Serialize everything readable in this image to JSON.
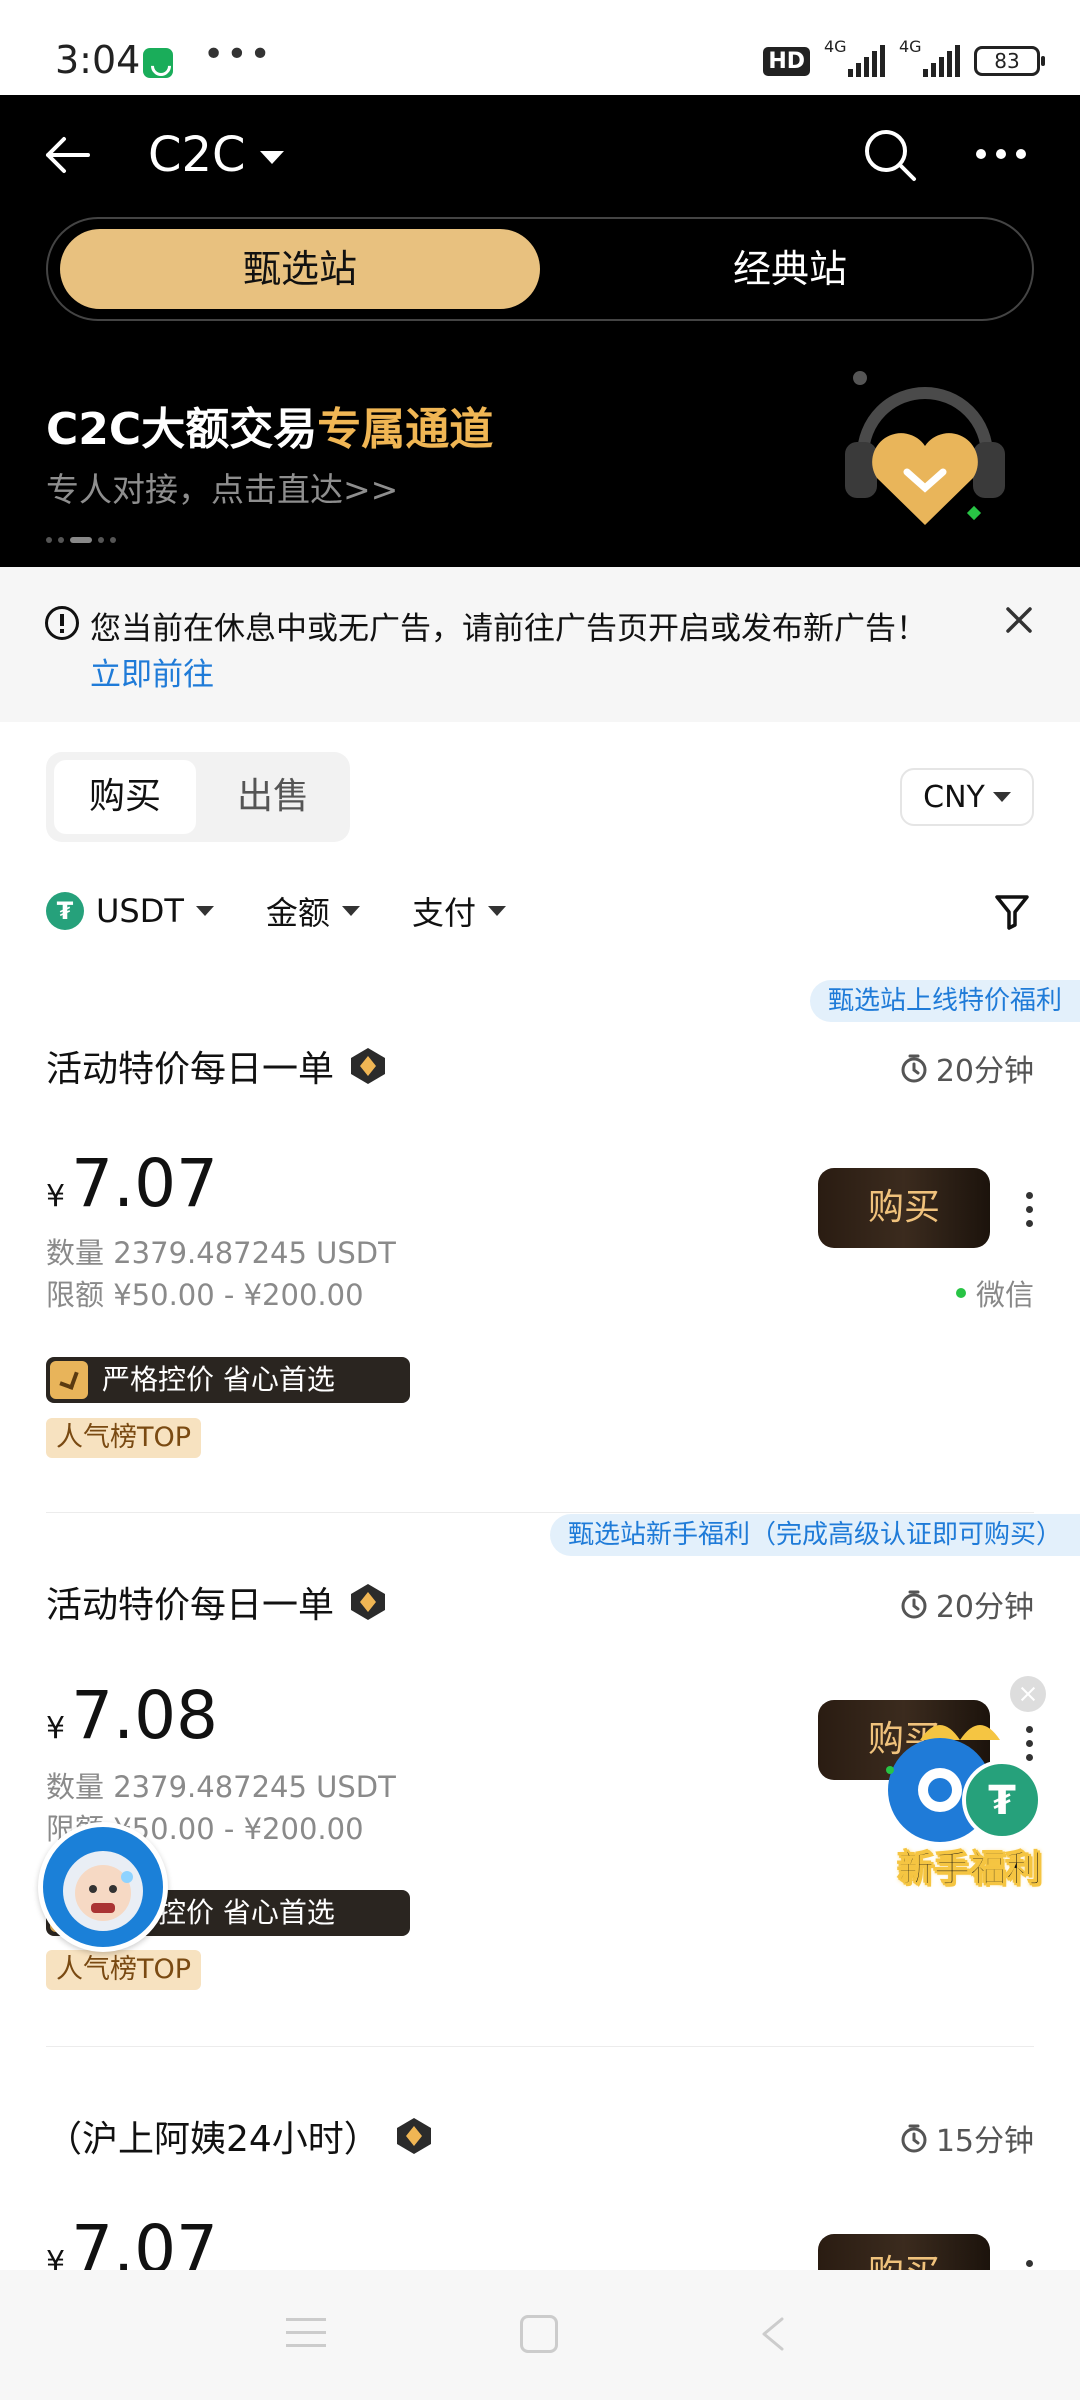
{
  "status_bar": {
    "time": "3:04",
    "dots": "•••",
    "hd": "HD",
    "net1": "4G",
    "net2": "4G",
    "battery": "83"
  },
  "header": {
    "title": "C2C",
    "segments": {
      "active": "甄选站",
      "inactive": "经典站"
    },
    "banner": {
      "title_main": "C2C大额交易",
      "title_accent": "专属通道",
      "subtitle": "专人对接，点击直达>>"
    }
  },
  "notice": {
    "text": "您当前在休息中或无广告，请前往广告页开启或发布新广告！",
    "link": "立即前往"
  },
  "trade_tabs": {
    "buy": "购买",
    "sell": "出售"
  },
  "currency": "CNY",
  "filters": {
    "coin": "USDT",
    "amount": "金额",
    "payment": "支付"
  },
  "ads": [
    {
      "badge": "甄选站上线特价福利",
      "name": "活动特价每日一单",
      "time": "20分钟",
      "currency_symbol": "¥",
      "price": "7.07",
      "quantity": "数量 2379.487245 USDT",
      "limit": "限额 ¥50.00 - ¥200.00",
      "buy_label": "购买",
      "payment": "微信",
      "tag_main": "严格控价 省心首选",
      "tag_rank": "人气榜TOP"
    },
    {
      "badge": "甄选站新手福利（完成高级认证即可购买）",
      "name": "活动特价每日一单",
      "time": "20分钟",
      "currency_symbol": "¥",
      "price": "7.08",
      "quantity": "数量 2379.487245 USDT",
      "limit": "限额 ¥50.00 - ¥200.00",
      "buy_label": "购买",
      "tag_main": "严格控价 省心首选",
      "tag_rank": "人气榜TOP"
    },
    {
      "name": "（沪上阿姨24小时）",
      "time": "15分钟",
      "currency_symbol": "¥",
      "price": "7.07",
      "buy_label": "购买"
    }
  ],
  "promo": {
    "label": "新手福利"
  },
  "colors": {
    "gold": "#e8c17f",
    "accent_text": "#f0b654",
    "link_blue": "#1f7bd8",
    "tether_green": "#26a17b"
  }
}
